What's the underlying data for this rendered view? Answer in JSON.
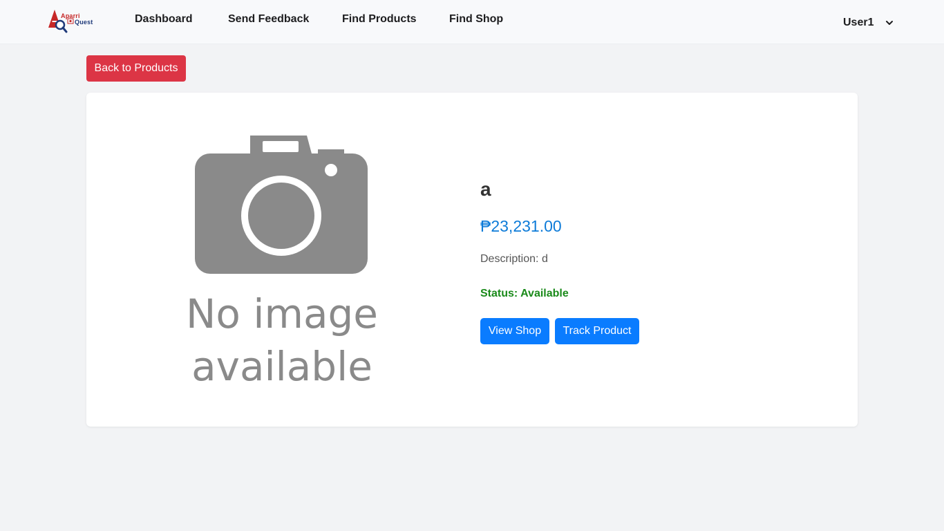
{
  "logo": {
    "line1": "Aparri",
    "line2": "Quest"
  },
  "nav": {
    "items": [
      "Dashboard",
      "Send Feedback",
      "Find Products",
      "Find Shop"
    ],
    "user": "User1"
  },
  "back_button": "Back to Products",
  "placeholder": {
    "line1": "No image",
    "line2": "available"
  },
  "product": {
    "name": "a",
    "price": "₱23,231.00",
    "description_label": "Description:",
    "description": "d",
    "status_label": "Status:",
    "status": "Available"
  },
  "actions": {
    "view_shop": "View Shop",
    "track_product": "Track Product"
  },
  "colors": {
    "danger": "#dc3545",
    "primary": "#0a7cff",
    "price": "#0d7bd8",
    "status": "#1a8a1a",
    "placeholder_gray": "#8a8a8a"
  },
  "icons": {
    "user_menu": "chevron-down-icon",
    "placeholder": "camera-icon"
  }
}
